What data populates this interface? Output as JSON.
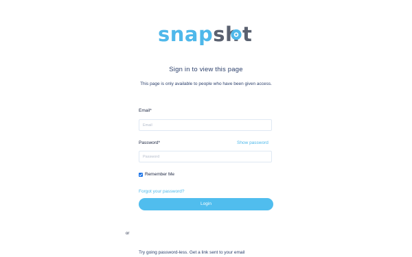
{
  "logo": {
    "text_part1": "snap",
    "text_part2": "sh",
    "text_part3": "t"
  },
  "heading": "Sign in to view this page",
  "subheading": "This page is only available to people who have been given access.",
  "form": {
    "email_label": "Email*",
    "email_placeholder": "Email",
    "password_label": "Password*",
    "show_password": "Show password",
    "password_placeholder": "Password",
    "remember_me": "Remember Me",
    "remember_checked": true,
    "forgot": "Forgot your password?",
    "login_button": "Login"
  },
  "or_text": "or",
  "passwordless": "Try going password-less. Get a link sent to your email",
  "colors": {
    "accent": "#50bdee",
    "logo_gray": "#5a6170",
    "text_dark": "#1b2540"
  }
}
